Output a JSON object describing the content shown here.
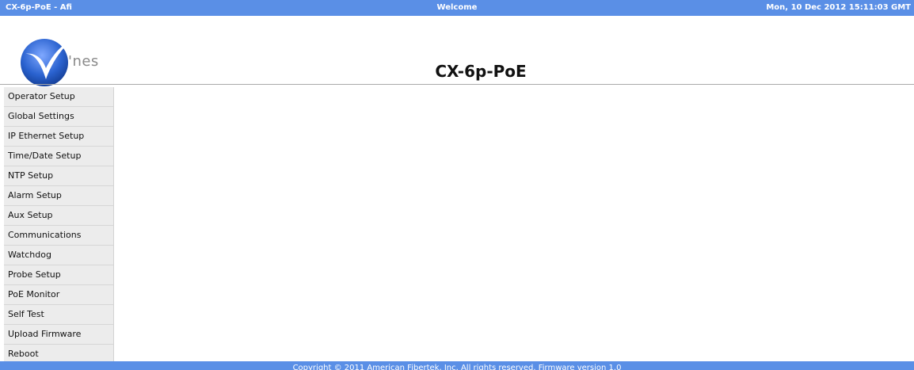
{
  "topbar": {
    "left": "CX-6p-PoE - Afi",
    "center": "Welcome",
    "right": "Mon, 10 Dec 2012 15:11:03 GMT"
  },
  "header": {
    "logo_text": "'nes",
    "title": "CX-6p-PoE"
  },
  "sidebar": {
    "items": [
      {
        "label": "Operator Setup"
      },
      {
        "label": "Global Settings"
      },
      {
        "label": "IP Ethernet Setup"
      },
      {
        "label": "Time/Date Setup"
      },
      {
        "label": "NTP Setup"
      },
      {
        "label": "Alarm Setup"
      },
      {
        "label": "Aux Setup"
      },
      {
        "label": "Communications"
      },
      {
        "label": "Watchdog"
      },
      {
        "label": "Probe Setup"
      },
      {
        "label": "PoE Monitor"
      },
      {
        "label": "Self Test"
      },
      {
        "label": "Upload Firmware"
      },
      {
        "label": "Reboot"
      }
    ]
  },
  "footer": {
    "text": "Copyright © 2011 American Fibertek, Inc. All rights reserved. Firmware version 1.0"
  },
  "colors": {
    "bar_blue": "#5a8fe6",
    "sidebar_bg": "#ececec",
    "logo_blue": "#1d55b8"
  },
  "icons": {
    "logo": "v-swoosh-logo-icon"
  }
}
